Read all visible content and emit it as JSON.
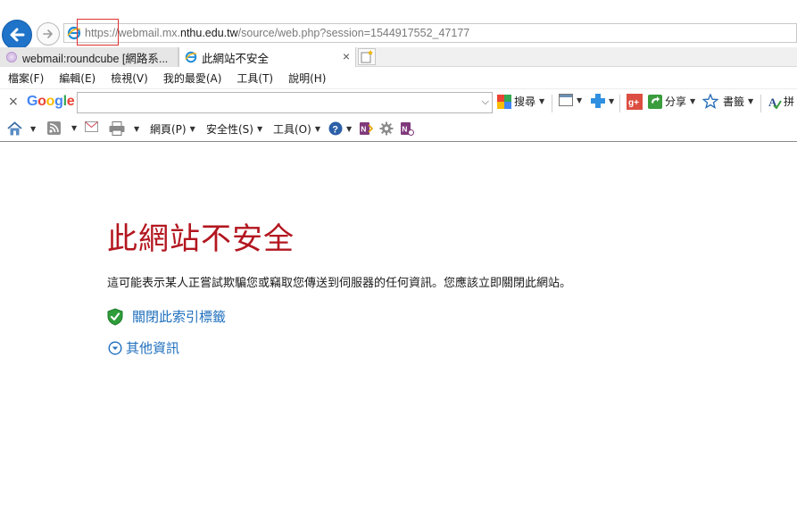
{
  "addressbar": {
    "url_scheme": "https://",
    "url_host_prefix": "webmail.mx.",
    "url_host_domain": "nthu.edu.tw",
    "url_path": "/source/web.php?session=1544917552_47177"
  },
  "tabs": [
    {
      "label": "webmail:roundcube [網路系..."
    },
    {
      "label": "此網站不安全",
      "close": "×"
    }
  ],
  "menu": [
    {
      "label": "檔案(F)"
    },
    {
      "label": "編輯(E)"
    },
    {
      "label": "檢視(V)"
    },
    {
      "label": "我的最愛(A)"
    },
    {
      "label": "工具(T)"
    },
    {
      "label": "說明(H)"
    }
  ],
  "google_toolbar": {
    "close": "×",
    "search_value": "",
    "search_label": "搜尋",
    "share_label": "分享",
    "bookmarks_label": "書籤",
    "spell_label": "拼"
  },
  "command_bar": {
    "page_label": "網頁(P)",
    "safety_label": "安全性(S)",
    "tools_label": "工具(O)"
  },
  "content": {
    "title": "此網站不安全",
    "description": "這可能表示某人正嘗試欺騙您或竊取您傳送到伺服器的任何資訊。您應該立即關閉此網站。",
    "close_tab_link": "關閉此索引標籤",
    "more_info_link": "其他資訊"
  },
  "colors": {
    "title_red": "#b3161f",
    "link_blue": "#1f6fbd",
    "back_button_blue": "#1f73c9"
  }
}
